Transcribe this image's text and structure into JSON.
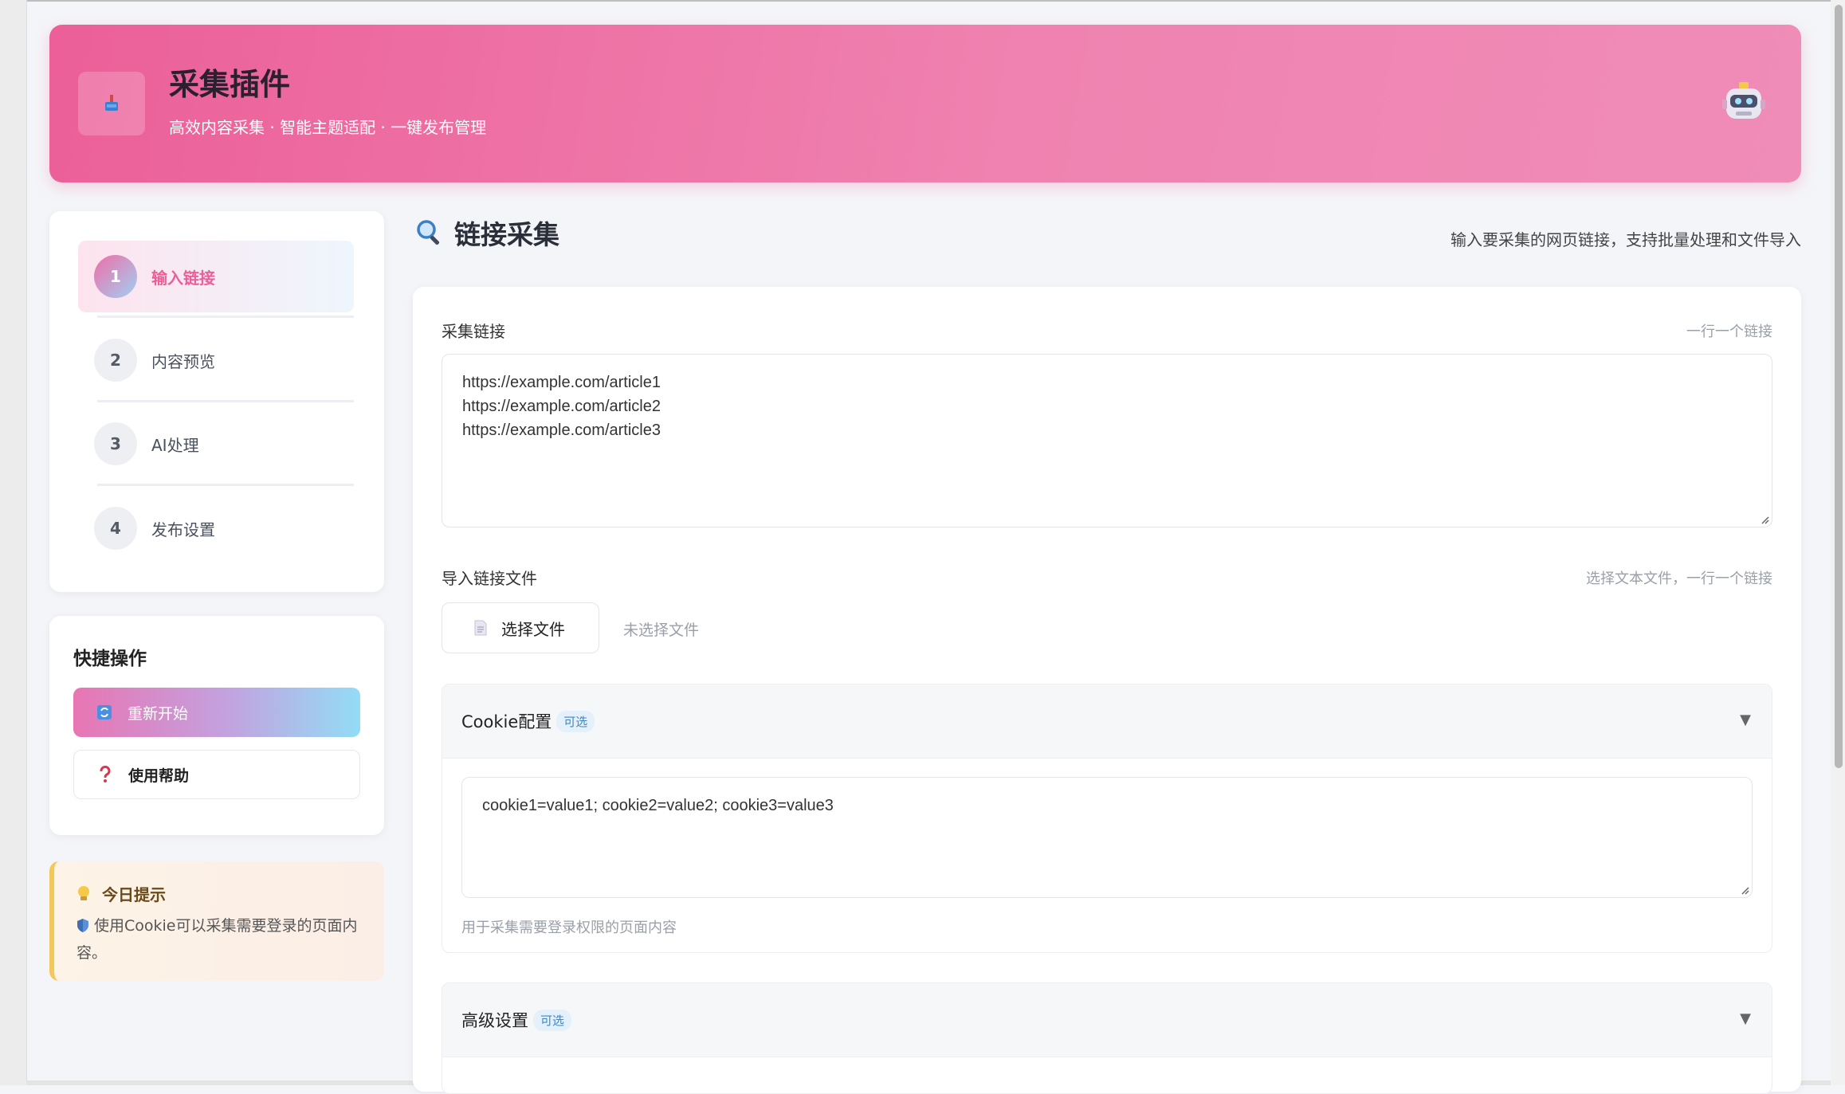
{
  "header": {
    "title": "采集插件",
    "subtitle": "高效内容采集 · 智能主题适配 · 一键发布管理",
    "logo_icon": "plunger-icon",
    "avatar_icon": "robot-icon"
  },
  "steps": [
    {
      "num": "1",
      "label": "输入链接",
      "active": true
    },
    {
      "num": "2",
      "label": "内容预览",
      "active": false
    },
    {
      "num": "3",
      "label": "AI处理",
      "active": false
    },
    {
      "num": "4",
      "label": "发布设置",
      "active": false
    }
  ],
  "quick": {
    "title": "快捷操作",
    "restart_label": "重新开始",
    "help_label": "使用帮助"
  },
  "tip": {
    "title": "今日提示",
    "text": "使用Cookie可以采集需要登录的页面内容。"
  },
  "section": {
    "title": "链接采集",
    "description": "输入要采集的网页链接，支持批量处理和文件导入"
  },
  "links_field": {
    "label": "采集链接",
    "hint": "一行一个链接",
    "lines": [
      "https://example.com/article1",
      "https://example.com/article2",
      "https://example.com/article3"
    ]
  },
  "file_field": {
    "label": "导入链接文件",
    "hint": "选择文本文件，一行一个链接",
    "button_label": "选择文件",
    "status": "未选择文件"
  },
  "cookie_panel": {
    "title": "Cookie配置",
    "badge": "可选",
    "value": "cookie1=value1; cookie2=value2; cookie3=value3",
    "hint": "用于采集需要登录权限的页面内容",
    "expanded": true
  },
  "advanced_panel": {
    "title": "高级设置",
    "badge": "可选",
    "expanded": false
  },
  "colors": {
    "accent": "#ec5f99",
    "badge_text": "#3d88c6",
    "tip_border": "#f4c75a"
  }
}
